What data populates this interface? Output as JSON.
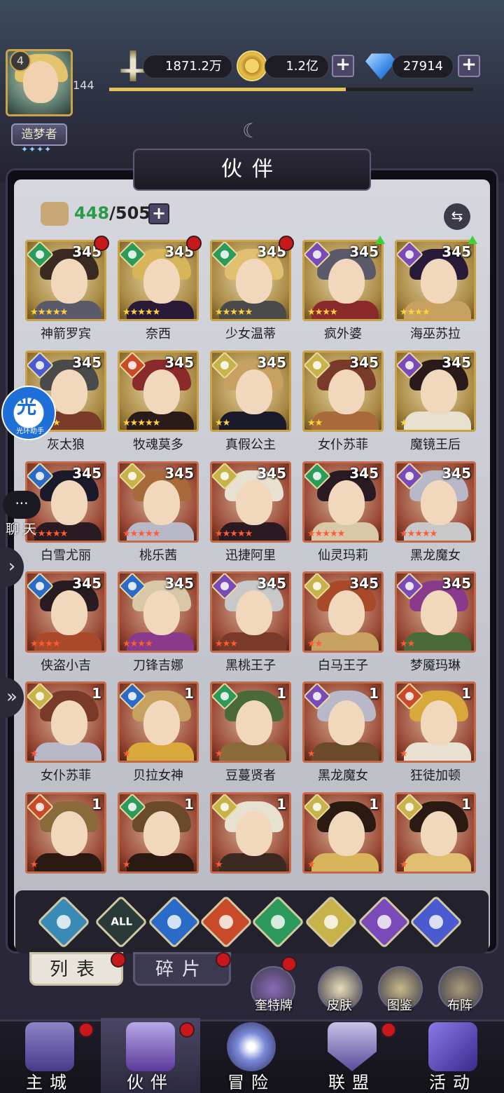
{
  "player": {
    "rank": "4",
    "level": "144",
    "title": "造梦者",
    "title_stars": "✦✦✦✦",
    "exp_fraction": 0.65
  },
  "resources": {
    "power": "1871.2万",
    "gold": "1.2亿",
    "diamonds": "27914"
  },
  "panel": {
    "title": "伙伴",
    "count_owned": "448",
    "count_sep": "/505"
  },
  "side": {
    "helper_char": "光",
    "helper_label": "光环助手",
    "chat_label": "聊天",
    "arrow1": "›",
    "arrow2": "»"
  },
  "heroes": [
    {
      "name": "神箭罗宾",
      "level": "345",
      "frame": "gold",
      "element": "wind",
      "stars": "★★★★★",
      "star_color": "y",
      "badge": "dot"
    },
    {
      "name": "奈西",
      "level": "345",
      "frame": "gold",
      "element": "wind",
      "stars": "★★★★★",
      "star_color": "y",
      "badge": "dot"
    },
    {
      "name": "少女温蒂",
      "level": "345",
      "frame": "gold",
      "element": "wind",
      "stars": "★★★★★",
      "star_color": "y",
      "badge": "dot"
    },
    {
      "name": "疯外婆",
      "level": "345",
      "frame": "gold",
      "element": "dark",
      "stars": "★★★★",
      "star_color": "y",
      "badge": "up"
    },
    {
      "name": "海巫苏拉",
      "level": "345",
      "frame": "gold",
      "element": "dark",
      "stars": "★★★★",
      "star_color": "y",
      "badge": "up"
    },
    {
      "name": "灰太狼",
      "level": "345",
      "frame": "gold",
      "element": "cosmos",
      "stars": "★★★★",
      "star_color": "y",
      "badge": ""
    },
    {
      "name": "牧魂莫多",
      "level": "345",
      "frame": "gold",
      "element": "fire",
      "stars": "★★★★★",
      "star_color": "y",
      "badge": ""
    },
    {
      "name": "真假公主",
      "level": "345",
      "frame": "gold",
      "element": "light",
      "stars": "★★",
      "star_color": "y",
      "badge": ""
    },
    {
      "name": "女仆苏菲",
      "level": "345",
      "frame": "gold",
      "element": "light",
      "stars": "★★",
      "star_color": "y",
      "badge": ""
    },
    {
      "name": "魔镜王后",
      "level": "345",
      "frame": "gold",
      "element": "dark",
      "stars": "★",
      "star_color": "y",
      "badge": ""
    },
    {
      "name": "白雪尤丽",
      "level": "345",
      "frame": "red",
      "element": "water",
      "stars": "★★★★★",
      "star_color": "r",
      "badge": ""
    },
    {
      "name": "桃乐茜",
      "level": "345",
      "frame": "red",
      "element": "light",
      "stars": "★★★★★",
      "star_color": "r",
      "badge": ""
    },
    {
      "name": "迅捷阿里",
      "level": "345",
      "frame": "red",
      "element": "light",
      "stars": "★★★★★",
      "star_color": "r",
      "badge": ""
    },
    {
      "name": "仙灵玛莉",
      "level": "345",
      "frame": "red",
      "element": "wind",
      "stars": "★★★★★",
      "star_color": "r",
      "badge": ""
    },
    {
      "name": "黑龙魔女",
      "level": "345",
      "frame": "red",
      "element": "dark",
      "stars": "★★★★★",
      "star_color": "r",
      "badge": ""
    },
    {
      "name": "侠盗小吉",
      "level": "345",
      "frame": "red",
      "element": "water",
      "stars": "★★★★",
      "star_color": "r",
      "badge": ""
    },
    {
      "name": "刀锋吉娜",
      "level": "345",
      "frame": "red",
      "element": "water",
      "stars": "★★★★",
      "star_color": "r",
      "badge": ""
    },
    {
      "name": "黑桃王子",
      "level": "345",
      "frame": "red",
      "element": "dark",
      "stars": "★★★",
      "star_color": "r",
      "badge": ""
    },
    {
      "name": "白马王子",
      "level": "345",
      "frame": "red",
      "element": "light",
      "stars": "★★",
      "star_color": "r",
      "badge": ""
    },
    {
      "name": "梦魇玛琳",
      "level": "345",
      "frame": "red",
      "element": "dark",
      "stars": "★★",
      "star_color": "r",
      "badge": ""
    },
    {
      "name": "女仆苏菲",
      "level": "1",
      "frame": "red",
      "element": "light",
      "stars": "★",
      "star_color": "r",
      "badge": ""
    },
    {
      "name": "贝拉女神",
      "level": "1",
      "frame": "red",
      "element": "water",
      "stars": "★",
      "star_color": "r",
      "badge": ""
    },
    {
      "name": "豆蔓贤者",
      "level": "1",
      "frame": "red",
      "element": "wind",
      "stars": "★",
      "star_color": "r",
      "badge": ""
    },
    {
      "name": "黑龙魔女",
      "level": "1",
      "frame": "red",
      "element": "dark",
      "stars": "★",
      "star_color": "r",
      "badge": ""
    },
    {
      "name": "狂徒加顿",
      "level": "1",
      "frame": "red",
      "element": "fire",
      "stars": "★",
      "star_color": "r",
      "badge": ""
    },
    {
      "name": "",
      "level": "1",
      "frame": "red",
      "element": "fire",
      "stars": "★",
      "star_color": "r",
      "badge": ""
    },
    {
      "name": "",
      "level": "1",
      "frame": "red",
      "element": "wind",
      "stars": "★",
      "star_color": "r",
      "badge": ""
    },
    {
      "name": "",
      "level": "1",
      "frame": "red",
      "element": "light",
      "stars": "★",
      "star_color": "r",
      "badge": ""
    },
    {
      "name": "",
      "level": "1",
      "frame": "red",
      "element": "light",
      "stars": "★",
      "star_color": "r",
      "badge": ""
    },
    {
      "name": "",
      "level": "1",
      "frame": "red",
      "element": "light",
      "stars": "★",
      "star_color": "r",
      "badge": ""
    }
  ],
  "filters": [
    {
      "icon": "rainbow-element-icon",
      "label": ""
    },
    {
      "icon": "all-icon",
      "label": "ALL"
    },
    {
      "icon": "water-element-icon",
      "label": ""
    },
    {
      "icon": "fire-element-icon",
      "label": ""
    },
    {
      "icon": "wind-element-icon",
      "label": ""
    },
    {
      "icon": "light-element-icon",
      "label": ""
    },
    {
      "icon": "dark-element-icon",
      "label": ""
    },
    {
      "icon": "cosmos-element-icon",
      "label": ""
    }
  ],
  "tabs": {
    "list": "列表",
    "shards": "碎片"
  },
  "subbuttons": {
    "cards": "奎特牌",
    "skins": "皮肤",
    "codex": "图鉴",
    "formation": "布阵"
  },
  "nav": {
    "main_city": "主城",
    "partners": "伙伴",
    "adventure": "冒险",
    "alliance": "联盟",
    "events": "活动"
  },
  "colors": {
    "wind": "#2c9a5a",
    "fire": "#c84a2a",
    "water": "#2a6ac8",
    "light": "#c8b24a",
    "dark": "#7a4ab8",
    "cosmos": "#4a5ad0",
    "rainbow": "#3a8ab8",
    "accent_gold": "#c9a24a"
  }
}
